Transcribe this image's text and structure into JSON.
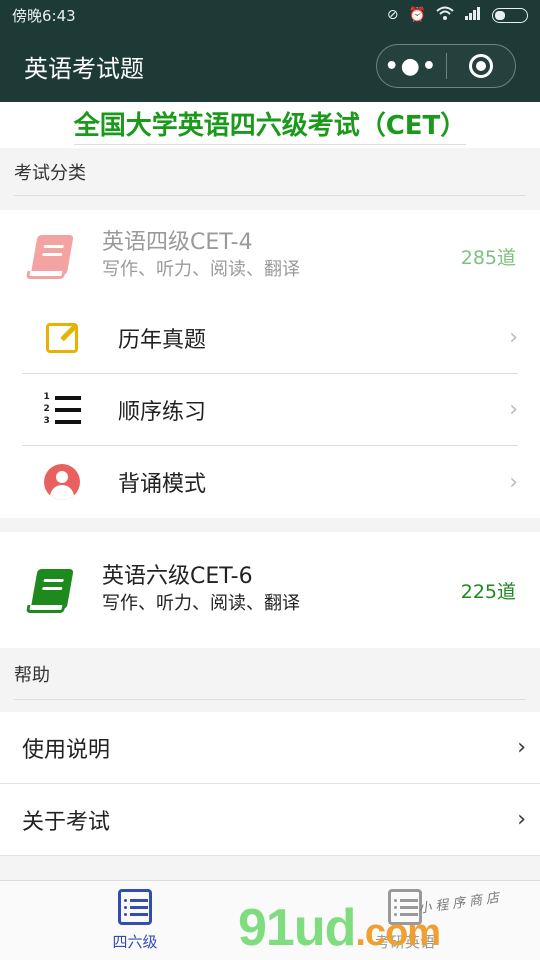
{
  "status_bar": {
    "carrier_time": "傍晚6:43",
    "icons": [
      "mute-icon",
      "alarm-icon",
      "wifi-icon",
      "signal-icon",
      "battery-icon"
    ]
  },
  "nav": {
    "title": "英语考试题",
    "capsule": [
      "more-icon",
      "close-target-icon"
    ]
  },
  "headline": "全国大学英语四六级考试（CET）",
  "categories_section": {
    "label": "考试分类",
    "cet4": {
      "name": "英语四级CET-4",
      "subtitle": "写作、听力、阅读、翻译",
      "count": "285道",
      "book_color": "#f4a3a3"
    },
    "menu": [
      {
        "label": "历年真题",
        "icon": "edit-icon"
      },
      {
        "label": "顺序练习",
        "icon": "numbered-list-icon"
      },
      {
        "label": "背诵模式",
        "icon": "person-icon"
      }
    ],
    "cet6": {
      "name": "英语六级CET-6",
      "subtitle": "写作、听力、阅读、翻译",
      "count": "225道",
      "book_color": "#1e8a1e"
    }
  },
  "help_section": {
    "label": "帮助",
    "items": [
      {
        "label": "使用说明"
      },
      {
        "label": "关于考试"
      }
    ]
  },
  "tabbar": {
    "tabs": [
      {
        "label": "四六级",
        "active": true
      },
      {
        "label": "考研英语",
        "active": false
      }
    ],
    "active_color": "#334cb0"
  },
  "watermark": {
    "brand": "91ud",
    "suffix": ".com",
    "tagline": "小程序商店"
  },
  "colors": {
    "nav_bg": "#1d3a36",
    "headline_green": "#1a9a1a"
  }
}
